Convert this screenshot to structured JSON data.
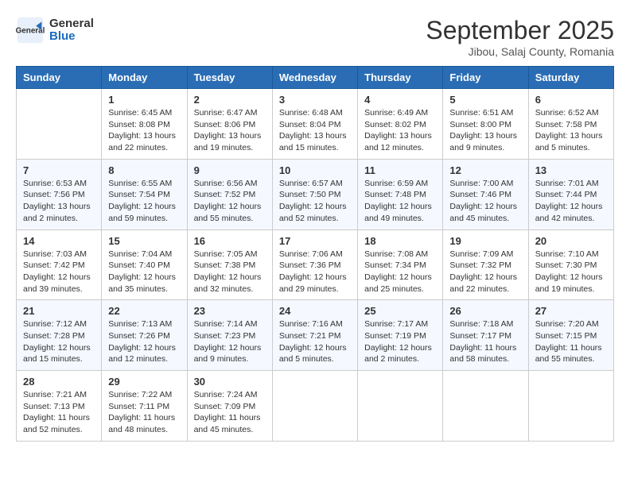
{
  "header": {
    "logo_general": "General",
    "logo_blue": "Blue",
    "month_title": "September 2025",
    "subtitle": "Jibou, Salaj County, Romania"
  },
  "days_of_week": [
    "Sunday",
    "Monday",
    "Tuesday",
    "Wednesday",
    "Thursday",
    "Friday",
    "Saturday"
  ],
  "weeks": [
    [
      {
        "day": "",
        "sunrise": "",
        "sunset": "",
        "daylight": ""
      },
      {
        "day": "1",
        "sunrise": "Sunrise: 6:45 AM",
        "sunset": "Sunset: 8:08 PM",
        "daylight": "Daylight: 13 hours and 22 minutes."
      },
      {
        "day": "2",
        "sunrise": "Sunrise: 6:47 AM",
        "sunset": "Sunset: 8:06 PM",
        "daylight": "Daylight: 13 hours and 19 minutes."
      },
      {
        "day": "3",
        "sunrise": "Sunrise: 6:48 AM",
        "sunset": "Sunset: 8:04 PM",
        "daylight": "Daylight: 13 hours and 15 minutes."
      },
      {
        "day": "4",
        "sunrise": "Sunrise: 6:49 AM",
        "sunset": "Sunset: 8:02 PM",
        "daylight": "Daylight: 13 hours and 12 minutes."
      },
      {
        "day": "5",
        "sunrise": "Sunrise: 6:51 AM",
        "sunset": "Sunset: 8:00 PM",
        "daylight": "Daylight: 13 hours and 9 minutes."
      },
      {
        "day": "6",
        "sunrise": "Sunrise: 6:52 AM",
        "sunset": "Sunset: 7:58 PM",
        "daylight": "Daylight: 13 hours and 5 minutes."
      }
    ],
    [
      {
        "day": "7",
        "sunrise": "Sunrise: 6:53 AM",
        "sunset": "Sunset: 7:56 PM",
        "daylight": "Daylight: 13 hours and 2 minutes."
      },
      {
        "day": "8",
        "sunrise": "Sunrise: 6:55 AM",
        "sunset": "Sunset: 7:54 PM",
        "daylight": "Daylight: 12 hours and 59 minutes."
      },
      {
        "day": "9",
        "sunrise": "Sunrise: 6:56 AM",
        "sunset": "Sunset: 7:52 PM",
        "daylight": "Daylight: 12 hours and 55 minutes."
      },
      {
        "day": "10",
        "sunrise": "Sunrise: 6:57 AM",
        "sunset": "Sunset: 7:50 PM",
        "daylight": "Daylight: 12 hours and 52 minutes."
      },
      {
        "day": "11",
        "sunrise": "Sunrise: 6:59 AM",
        "sunset": "Sunset: 7:48 PM",
        "daylight": "Daylight: 12 hours and 49 minutes."
      },
      {
        "day": "12",
        "sunrise": "Sunrise: 7:00 AM",
        "sunset": "Sunset: 7:46 PM",
        "daylight": "Daylight: 12 hours and 45 minutes."
      },
      {
        "day": "13",
        "sunrise": "Sunrise: 7:01 AM",
        "sunset": "Sunset: 7:44 PM",
        "daylight": "Daylight: 12 hours and 42 minutes."
      }
    ],
    [
      {
        "day": "14",
        "sunrise": "Sunrise: 7:03 AM",
        "sunset": "Sunset: 7:42 PM",
        "daylight": "Daylight: 12 hours and 39 minutes."
      },
      {
        "day": "15",
        "sunrise": "Sunrise: 7:04 AM",
        "sunset": "Sunset: 7:40 PM",
        "daylight": "Daylight: 12 hours and 35 minutes."
      },
      {
        "day": "16",
        "sunrise": "Sunrise: 7:05 AM",
        "sunset": "Sunset: 7:38 PM",
        "daylight": "Daylight: 12 hours and 32 minutes."
      },
      {
        "day": "17",
        "sunrise": "Sunrise: 7:06 AM",
        "sunset": "Sunset: 7:36 PM",
        "daylight": "Daylight: 12 hours and 29 minutes."
      },
      {
        "day": "18",
        "sunrise": "Sunrise: 7:08 AM",
        "sunset": "Sunset: 7:34 PM",
        "daylight": "Daylight: 12 hours and 25 minutes."
      },
      {
        "day": "19",
        "sunrise": "Sunrise: 7:09 AM",
        "sunset": "Sunset: 7:32 PM",
        "daylight": "Daylight: 12 hours and 22 minutes."
      },
      {
        "day": "20",
        "sunrise": "Sunrise: 7:10 AM",
        "sunset": "Sunset: 7:30 PM",
        "daylight": "Daylight: 12 hours and 19 minutes."
      }
    ],
    [
      {
        "day": "21",
        "sunrise": "Sunrise: 7:12 AM",
        "sunset": "Sunset: 7:28 PM",
        "daylight": "Daylight: 12 hours and 15 minutes."
      },
      {
        "day": "22",
        "sunrise": "Sunrise: 7:13 AM",
        "sunset": "Sunset: 7:26 PM",
        "daylight": "Daylight: 12 hours and 12 minutes."
      },
      {
        "day": "23",
        "sunrise": "Sunrise: 7:14 AM",
        "sunset": "Sunset: 7:23 PM",
        "daylight": "Daylight: 12 hours and 9 minutes."
      },
      {
        "day": "24",
        "sunrise": "Sunrise: 7:16 AM",
        "sunset": "Sunset: 7:21 PM",
        "daylight": "Daylight: 12 hours and 5 minutes."
      },
      {
        "day": "25",
        "sunrise": "Sunrise: 7:17 AM",
        "sunset": "Sunset: 7:19 PM",
        "daylight": "Daylight: 12 hours and 2 minutes."
      },
      {
        "day": "26",
        "sunrise": "Sunrise: 7:18 AM",
        "sunset": "Sunset: 7:17 PM",
        "daylight": "Daylight: 11 hours and 58 minutes."
      },
      {
        "day": "27",
        "sunrise": "Sunrise: 7:20 AM",
        "sunset": "Sunset: 7:15 PM",
        "daylight": "Daylight: 11 hours and 55 minutes."
      }
    ],
    [
      {
        "day": "28",
        "sunrise": "Sunrise: 7:21 AM",
        "sunset": "Sunset: 7:13 PM",
        "daylight": "Daylight: 11 hours and 52 minutes."
      },
      {
        "day": "29",
        "sunrise": "Sunrise: 7:22 AM",
        "sunset": "Sunset: 7:11 PM",
        "daylight": "Daylight: 11 hours and 48 minutes."
      },
      {
        "day": "30",
        "sunrise": "Sunrise: 7:24 AM",
        "sunset": "Sunset: 7:09 PM",
        "daylight": "Daylight: 11 hours and 45 minutes."
      },
      {
        "day": "",
        "sunrise": "",
        "sunset": "",
        "daylight": ""
      },
      {
        "day": "",
        "sunrise": "",
        "sunset": "",
        "daylight": ""
      },
      {
        "day": "",
        "sunrise": "",
        "sunset": "",
        "daylight": ""
      },
      {
        "day": "",
        "sunrise": "",
        "sunset": "",
        "daylight": ""
      }
    ]
  ]
}
